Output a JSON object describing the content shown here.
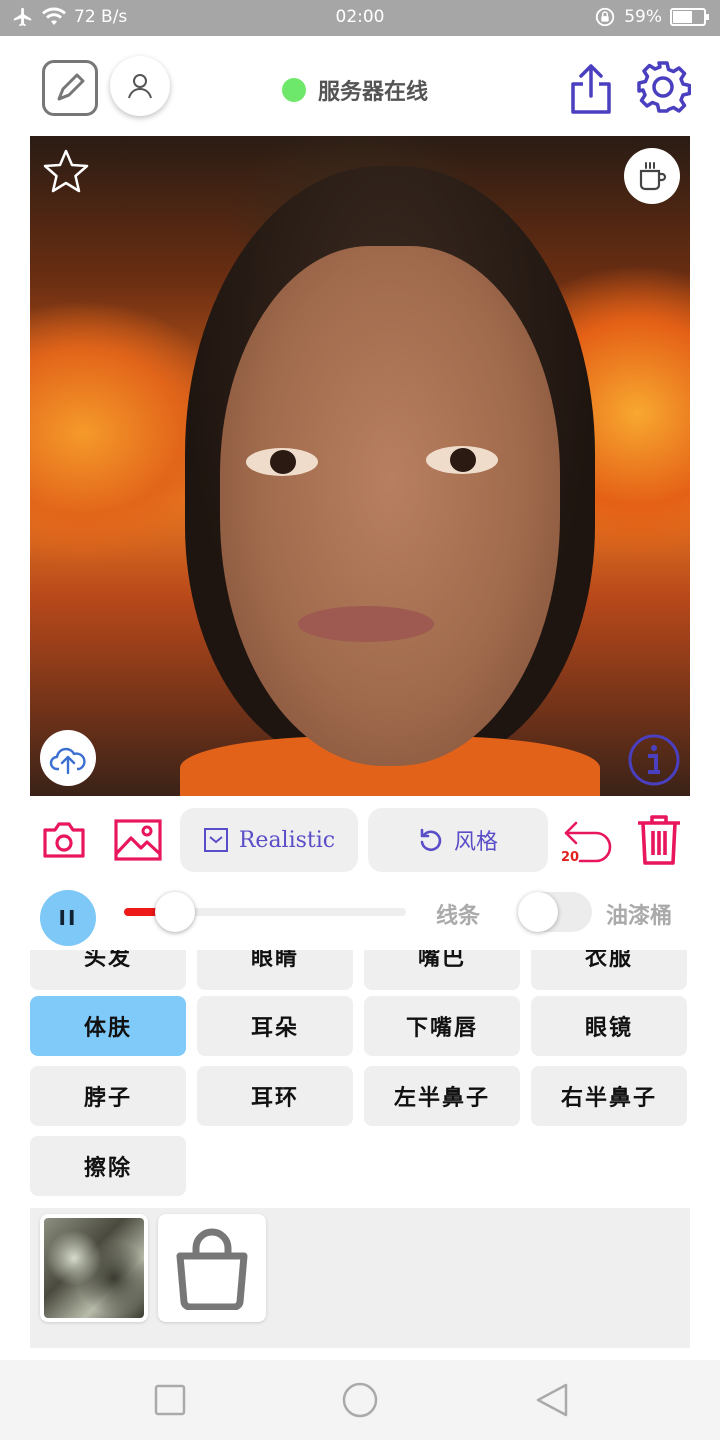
{
  "status_bar": {
    "network_speed": "72 B/s",
    "time": "02:00",
    "battery": "59%"
  },
  "header": {
    "server_status": "服务器在线",
    "server_status_color": "#6ee86a"
  },
  "toolbar": {
    "style_label": "Realistic",
    "reset_style_label": "风格",
    "undo_count": "20",
    "accent_color": "#e8175d"
  },
  "controls": {
    "pause_label": "II",
    "brush_level": 0.18,
    "line_label": "线条",
    "bucket_label": "油漆桶",
    "bucket_toggle": "off"
  },
  "parts": [
    {
      "label": "头发",
      "selected": false
    },
    {
      "label": "眼睛",
      "selected": false
    },
    {
      "label": "嘴巴",
      "selected": false
    },
    {
      "label": "衣服",
      "selected": false
    },
    {
      "label": "体肤",
      "selected": true
    },
    {
      "label": "耳朵",
      "selected": false
    },
    {
      "label": "下嘴唇",
      "selected": false
    },
    {
      "label": "眼镜",
      "selected": false
    },
    {
      "label": "脖子",
      "selected": false
    },
    {
      "label": "耳环",
      "selected": false
    },
    {
      "label": "左半鼻子",
      "selected": false
    },
    {
      "label": "右半鼻子",
      "selected": false
    },
    {
      "label": "擦除",
      "selected": false
    }
  ],
  "icons": [
    "airplane-icon",
    "wifi-icon",
    "lock-rotation-icon",
    "battery-icon",
    "edit-icon",
    "user-icon",
    "share-icon",
    "gear-icon",
    "star-icon",
    "cup-icon",
    "cloud-upload-icon",
    "info-icon",
    "camera-icon",
    "image-icon",
    "dropdown-icon",
    "refresh-icon",
    "undo-icon",
    "trash-icon",
    "shopping-bag-icon"
  ]
}
